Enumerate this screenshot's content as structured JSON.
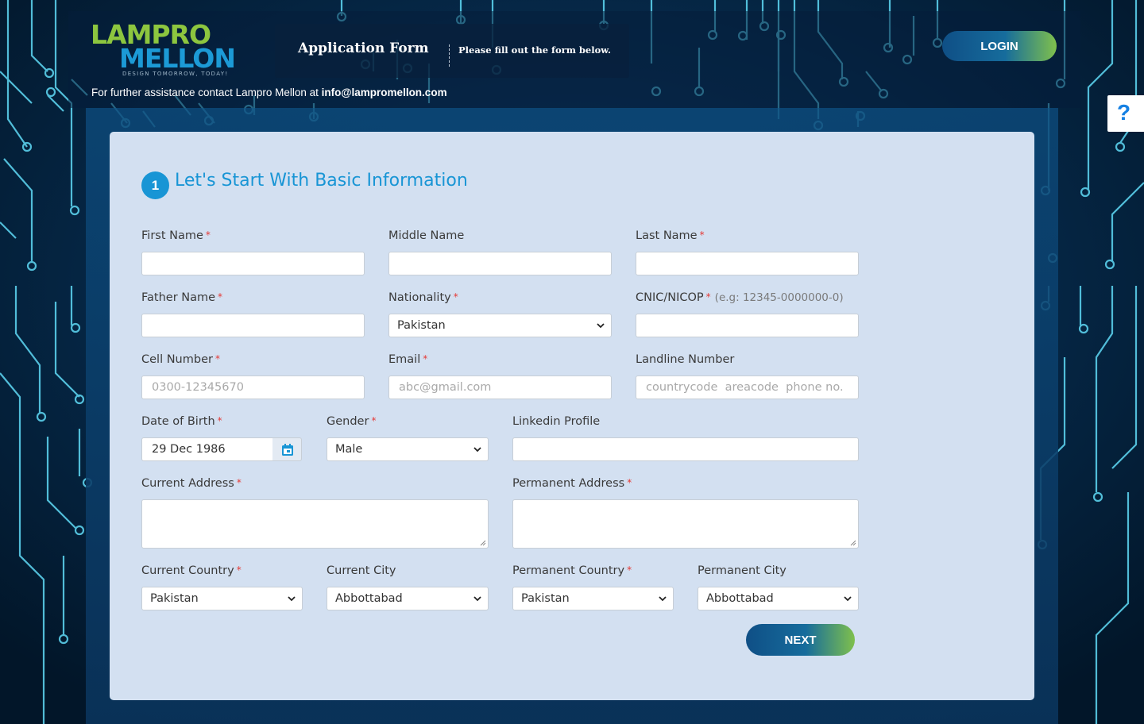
{
  "header": {
    "logo_top": "LAMPRO",
    "logo_bottom": "MELLON",
    "logo_tagline": "DESIGN TOMORROW, TODAY!",
    "app_title": "Application Form",
    "app_subtitle": "Please fill out the form below.",
    "login_label": "LOGIN",
    "contact_text": "For further assistance contact Lampro Mellon at ",
    "contact_email": "info@lampromellon.com"
  },
  "help": {
    "label": "?"
  },
  "form": {
    "step_number": "1",
    "section_title": "Let's Start With Basic Information",
    "required_mark": "*",
    "fields": {
      "first_name": {
        "label": "First Name",
        "value": "",
        "placeholder": ""
      },
      "middle_name": {
        "label": "Middle Name",
        "value": "",
        "placeholder": ""
      },
      "last_name": {
        "label": "Last Name",
        "value": "",
        "placeholder": ""
      },
      "father_name": {
        "label": "Father Name",
        "value": "",
        "placeholder": ""
      },
      "nationality": {
        "label": "Nationality",
        "value": "Pakistan"
      },
      "cnic": {
        "label": "CNIC/NICOP",
        "hint": "(e.g: 12345-0000000-0)",
        "value": ""
      },
      "cell": {
        "label": "Cell Number",
        "placeholder": "0300-12345670"
      },
      "email": {
        "label": "Email",
        "placeholder": "abc@gmail.com"
      },
      "landline": {
        "label": "Landline Number",
        "placeholder": "countrycode  areacode  phone no."
      },
      "dob": {
        "label": "Date of Birth",
        "value": "29 Dec 1986"
      },
      "gender": {
        "label": "Gender",
        "value": "Male"
      },
      "linkedin": {
        "label": "Linkedin Profile",
        "value": ""
      },
      "current_address": {
        "label": "Current Address",
        "value": ""
      },
      "permanent_address": {
        "label": "Permanent Address",
        "value": ""
      },
      "current_country": {
        "label": "Current Country",
        "value": "Pakistan"
      },
      "current_city": {
        "label": "Current City",
        "value": "Abbottabad"
      },
      "permanent_country": {
        "label": "Permanent Country",
        "value": "Pakistan"
      },
      "permanent_city": {
        "label": "Permanent City",
        "value": "Abbottabad"
      }
    },
    "next_label": "NEXT"
  },
  "colors": {
    "accent": "#1895d5",
    "background": "#03203c",
    "card": "#d3e0f1",
    "circuit": "#5fd9f5",
    "logo_green": "#8dc63f",
    "required": "#e53935"
  }
}
